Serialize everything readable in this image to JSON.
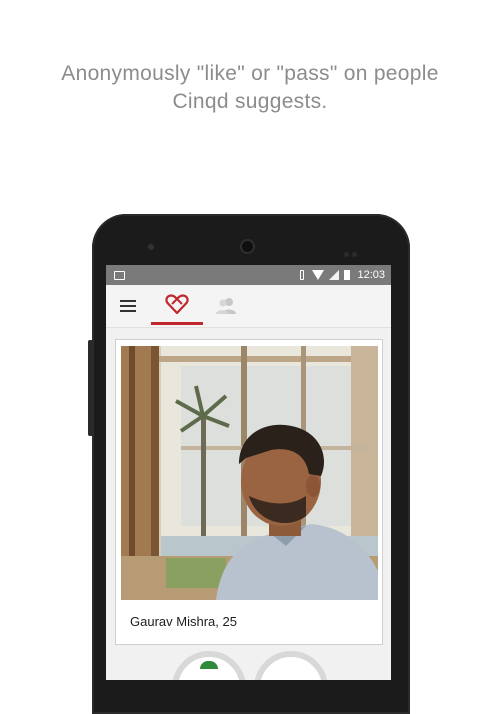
{
  "headline": {
    "line1": "Anonymously \"like\" or \"pass\" on people",
    "line2": "Cinqd suggests."
  },
  "statusbar": {
    "time": "12:03",
    "icons": [
      "gallery-icon",
      "vibrate-icon",
      "wifi-icon",
      "signal-icon",
      "battery-icon"
    ]
  },
  "appbar": {
    "menu_icon": "hamburger-menu-icon",
    "tabs": [
      {
        "name": "like-tab",
        "icon": "heart-icon",
        "active": true
      },
      {
        "name": "people-tab",
        "icon": "people-icon",
        "active": false
      }
    ]
  },
  "card": {
    "name_age": "Gaurav Mishra, 25"
  },
  "colors": {
    "accent": "#c0262d",
    "statusbar": "#7a7a7a",
    "headline": "#8c8c8c"
  }
}
